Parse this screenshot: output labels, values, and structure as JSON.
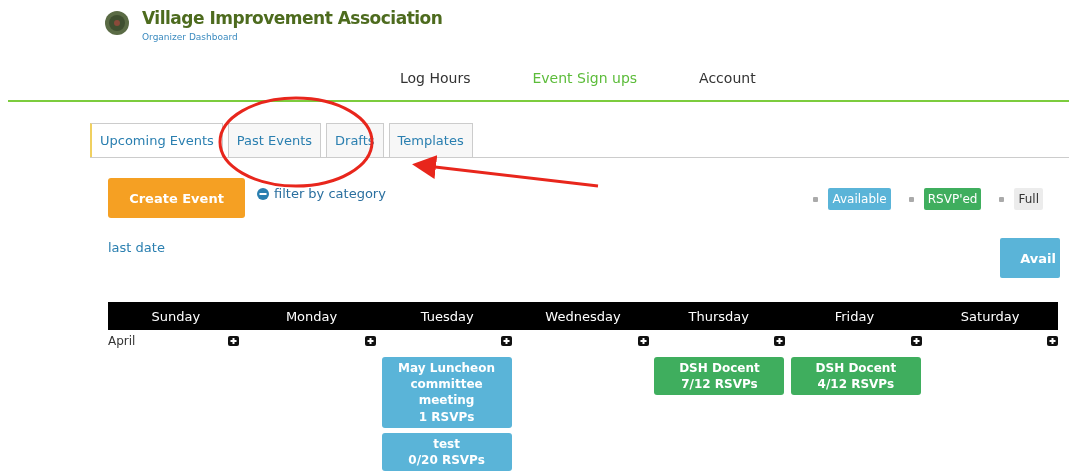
{
  "header": {
    "title": "Village Improvement Association",
    "subtitle": "Organizer Dashboard"
  },
  "nav": [
    {
      "label": "Log Hours",
      "selected": false
    },
    {
      "label": "Event Sign ups",
      "selected": true
    },
    {
      "label": "Account",
      "selected": false
    }
  ],
  "tabs": [
    {
      "label": "Upcoming Events",
      "selected": true
    },
    {
      "label": "Past Events",
      "selected": false
    },
    {
      "label": "Drafts",
      "selected": false
    },
    {
      "label": "Templates",
      "selected": false
    }
  ],
  "create_button": "Create Event",
  "filter_link": "filter by category",
  "legend": [
    {
      "label": "Available",
      "color": "#5ab4d8"
    },
    {
      "label": "RSVP'ed",
      "color": "#3fae5e"
    },
    {
      "label": "Full",
      "color": "#ececec"
    }
  ],
  "date_link": "last date",
  "avail_button": "Avail",
  "calendar": {
    "days": [
      "Sunday",
      "Monday",
      "Tuesday",
      "Wednesday",
      "Thursday",
      "Friday",
      "Saturday"
    ],
    "month": "April",
    "cells": [
      {},
      {},
      {
        "events": [
          {
            "title": "May Luncheon committee meeting",
            "rsvps": "1 RSVPs",
            "color": "#5ab4d8"
          },
          {
            "title": "test",
            "rsvps": "0/20 RSVPs",
            "color": "#5ab4d8"
          }
        ]
      },
      {},
      {
        "events": [
          {
            "title": "DSH Docent",
            "rsvps": "7/12 RSVPs",
            "color": "#3fae5e"
          }
        ]
      },
      {
        "events": [
          {
            "title": "DSH Docent",
            "rsvps": "4/12 RSVPs",
            "color": "#3fae5e"
          }
        ]
      },
      {}
    ]
  }
}
